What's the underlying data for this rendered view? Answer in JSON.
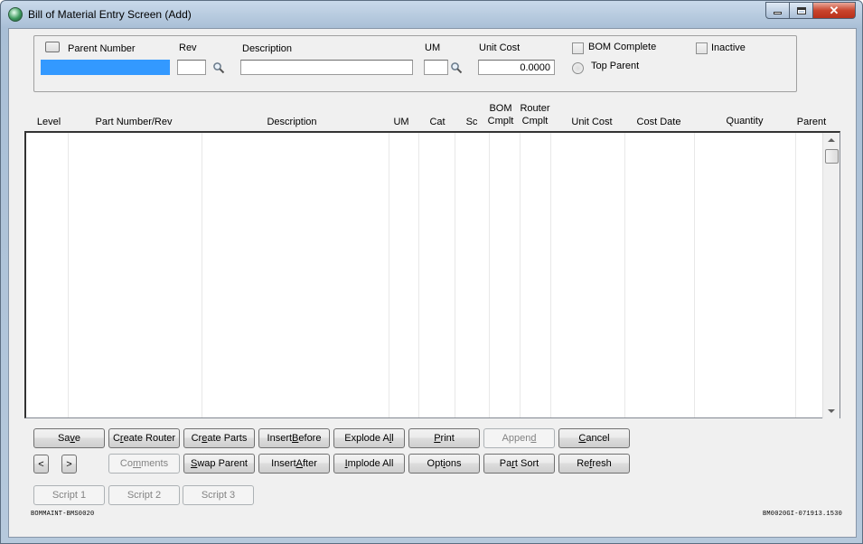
{
  "window": {
    "title": "Bill of Material Entry Screen (Add)",
    "controls": {
      "minimize": "minimize-icon",
      "maximize": "maximize-icon",
      "close": "✕"
    }
  },
  "header": {
    "parent_number_label": "Parent Number",
    "parent_number_value": "",
    "rev_label": "Rev",
    "rev_value": "",
    "description_label": "Description",
    "description_value": "",
    "um_label": "UM",
    "um_value": "",
    "unit_cost_label": "Unit Cost",
    "unit_cost_value": "0.0000",
    "bom_complete_label": "BOM Complete",
    "top_parent_label": "Top Parent",
    "inactive_label": "Inactive"
  },
  "grid": {
    "columns": [
      {
        "line1": "",
        "line2": "Level"
      },
      {
        "line1": "",
        "line2": "Part Number/Rev"
      },
      {
        "line1": "",
        "line2": "Description"
      },
      {
        "line1": "",
        "line2": "UM"
      },
      {
        "line1": "",
        "line2": "Cat"
      },
      {
        "line1": "",
        "line2": "Sc"
      },
      {
        "line1": "BOM",
        "line2": "Cmplt"
      },
      {
        "line1": "Router",
        "line2": "Cmplt"
      },
      {
        "line1": "",
        "line2": "Unit Cost"
      },
      {
        "line1": "",
        "line2": "Cost Date"
      },
      {
        "line1": "",
        "line2": "Quantity"
      },
      {
        "line1": "",
        "line2": "Parent"
      }
    ],
    "rows": []
  },
  "buttons": {
    "row1": [
      {
        "pre": "Sa",
        "u": "v",
        "post": "e",
        "enabled": true
      },
      {
        "pre": "C",
        "u": "r",
        "post": "eate Router",
        "enabled": true
      },
      {
        "pre": "Cr",
        "u": "e",
        "post": "ate Parts",
        "enabled": true
      },
      {
        "pre": "Insert ",
        "u": "B",
        "post": "efore",
        "enabled": true
      },
      {
        "pre": "Explode A",
        "u": "l",
        "post": "l",
        "enabled": true
      },
      {
        "pre": "",
        "u": "P",
        "post": "rint",
        "enabled": true
      },
      {
        "pre": "Appen",
        "u": "d",
        "post": "",
        "enabled": false
      },
      {
        "pre": "",
        "u": "C",
        "post": "ancel",
        "enabled": true
      }
    ],
    "prev": "<",
    "next": ">",
    "row2": [
      {
        "pre": "Co",
        "u": "m",
        "post": "ments",
        "enabled": false
      },
      {
        "pre": "",
        "u": "S",
        "post": "wap Parent",
        "enabled": true
      },
      {
        "pre": "Insert ",
        "u": "A",
        "post": "fter",
        "enabled": true
      },
      {
        "pre": "",
        "u": "I",
        "post": "mplode All",
        "enabled": true
      },
      {
        "pre": "Opt",
        "u": "i",
        "post": "ons",
        "enabled": true
      },
      {
        "pre": "Pa",
        "u": "r",
        "post": "t Sort",
        "enabled": true
      },
      {
        "pre": "Re",
        "u": "f",
        "post": "resh",
        "enabled": true
      }
    ],
    "scripts": [
      "Script 1",
      "Script 2",
      "Script 3"
    ]
  },
  "footer": {
    "left": "BOMMAINT-BMS0020",
    "right": "BM0020GI-071913.1530"
  }
}
